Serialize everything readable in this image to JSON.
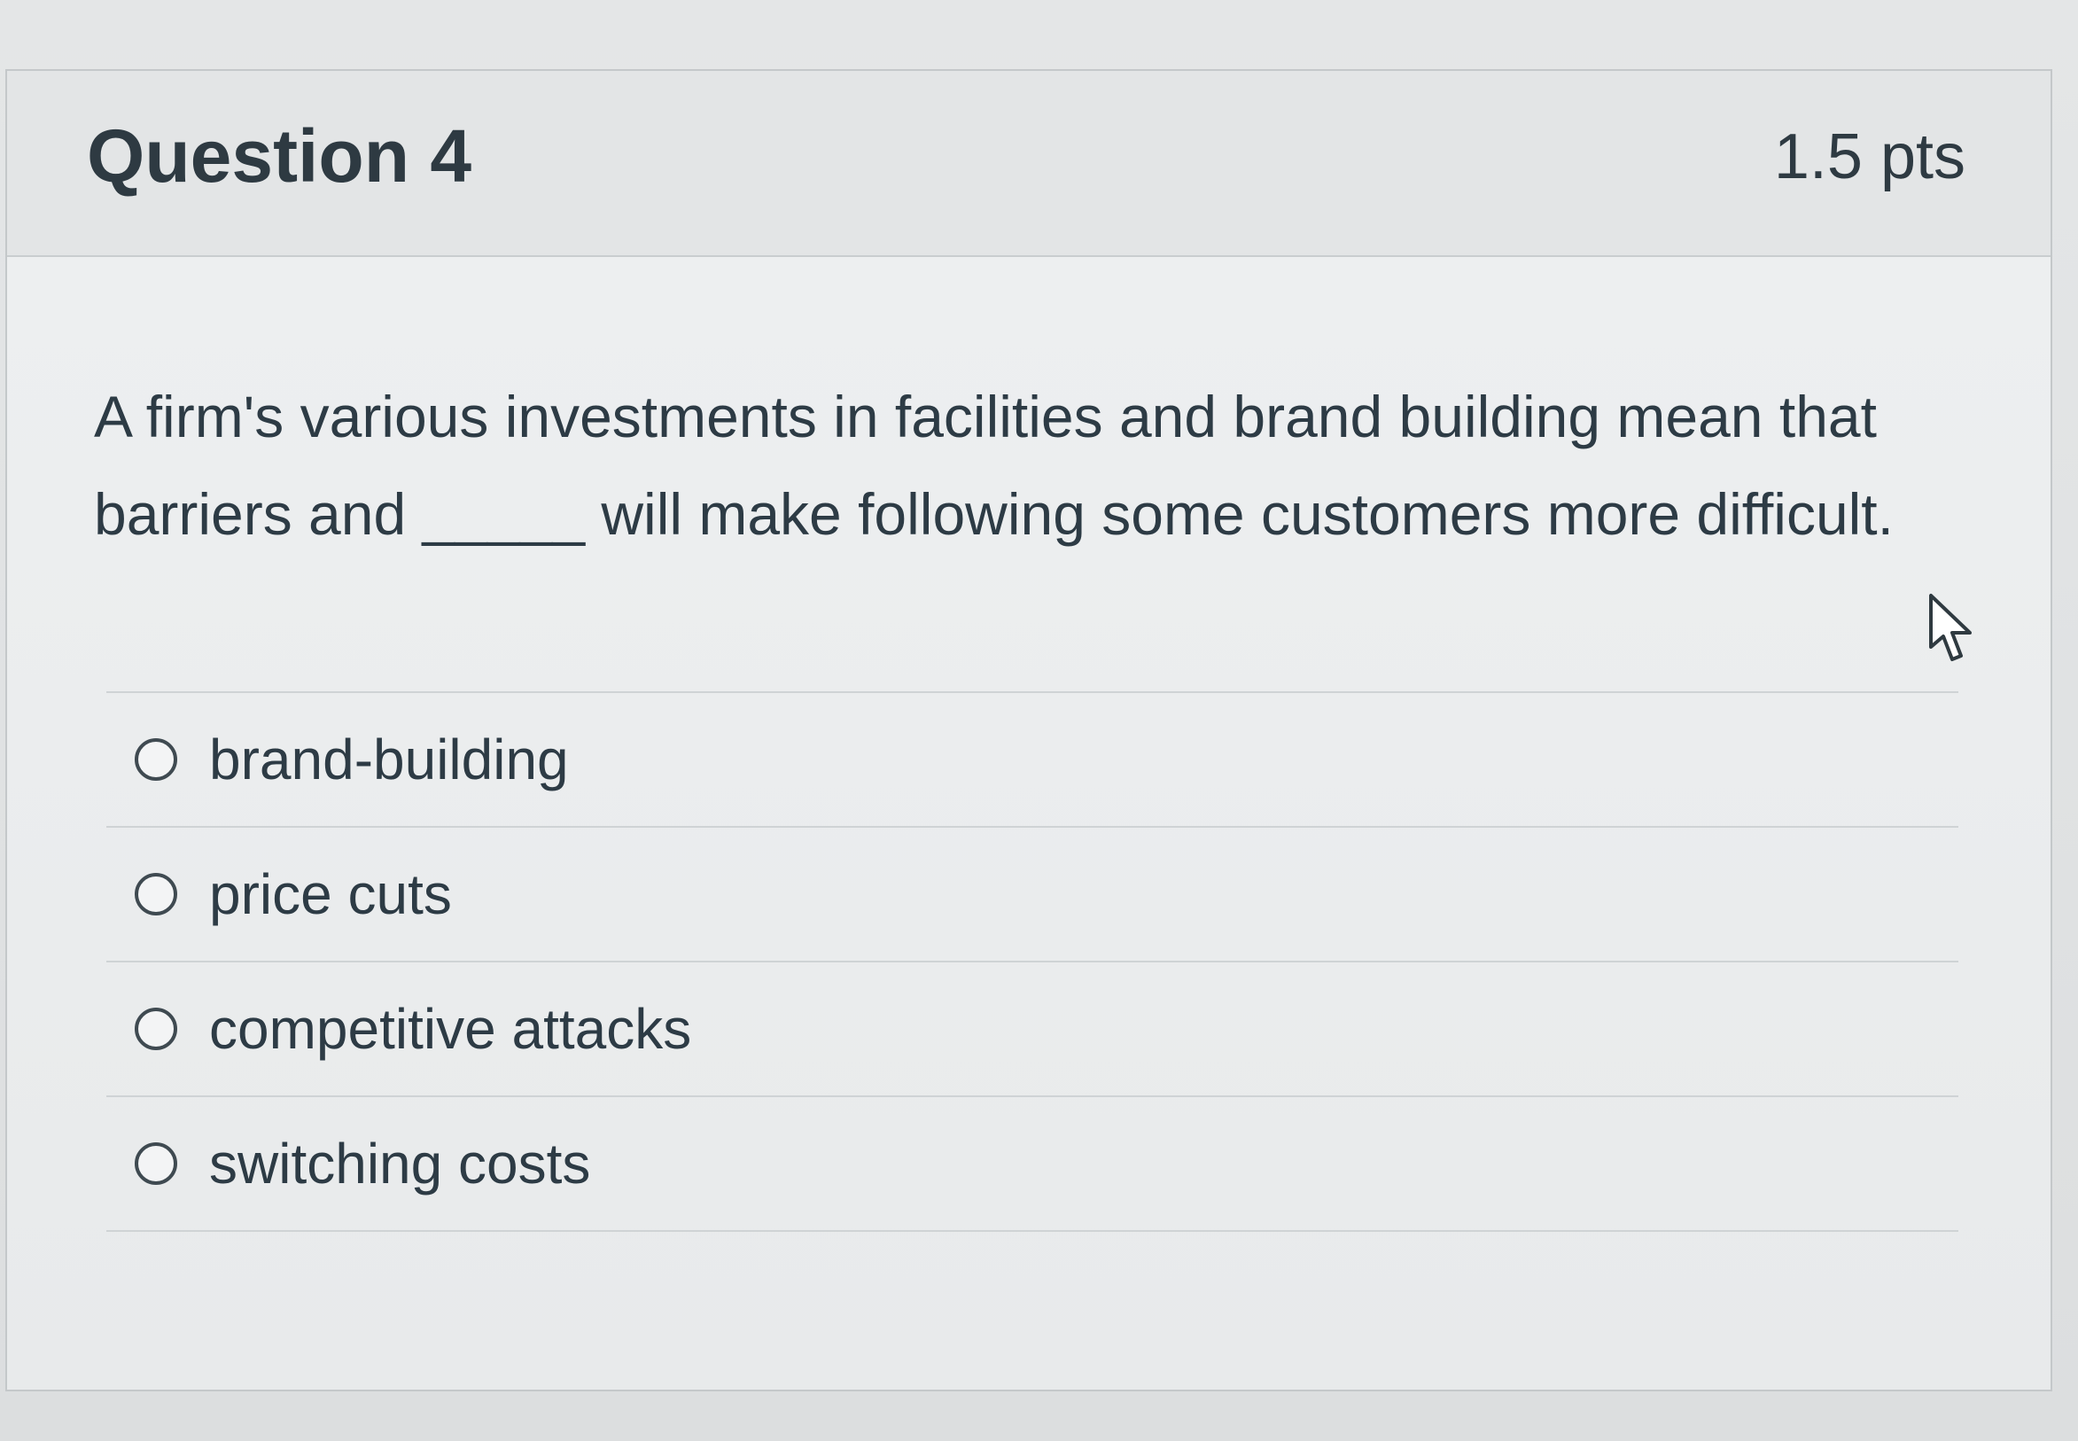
{
  "question": {
    "title": "Question 4",
    "points": "1.5 pts",
    "text": "A firm's various investments in facilities and brand building mean that barriers and _____ will make following some customers more difficult."
  },
  "answers": [
    {
      "label": "brand-building",
      "selected": false
    },
    {
      "label": "price cuts",
      "selected": false
    },
    {
      "label": "competitive attacks",
      "selected": false
    },
    {
      "label": "switching costs",
      "selected": false
    }
  ],
  "icons": {
    "radio": "radio-button-icon",
    "cursor": "mouse-pointer-icon"
  },
  "colors": {
    "text": "#2d3b45",
    "header_bg": "#e3e5e6",
    "border": "#c9cdcf"
  }
}
